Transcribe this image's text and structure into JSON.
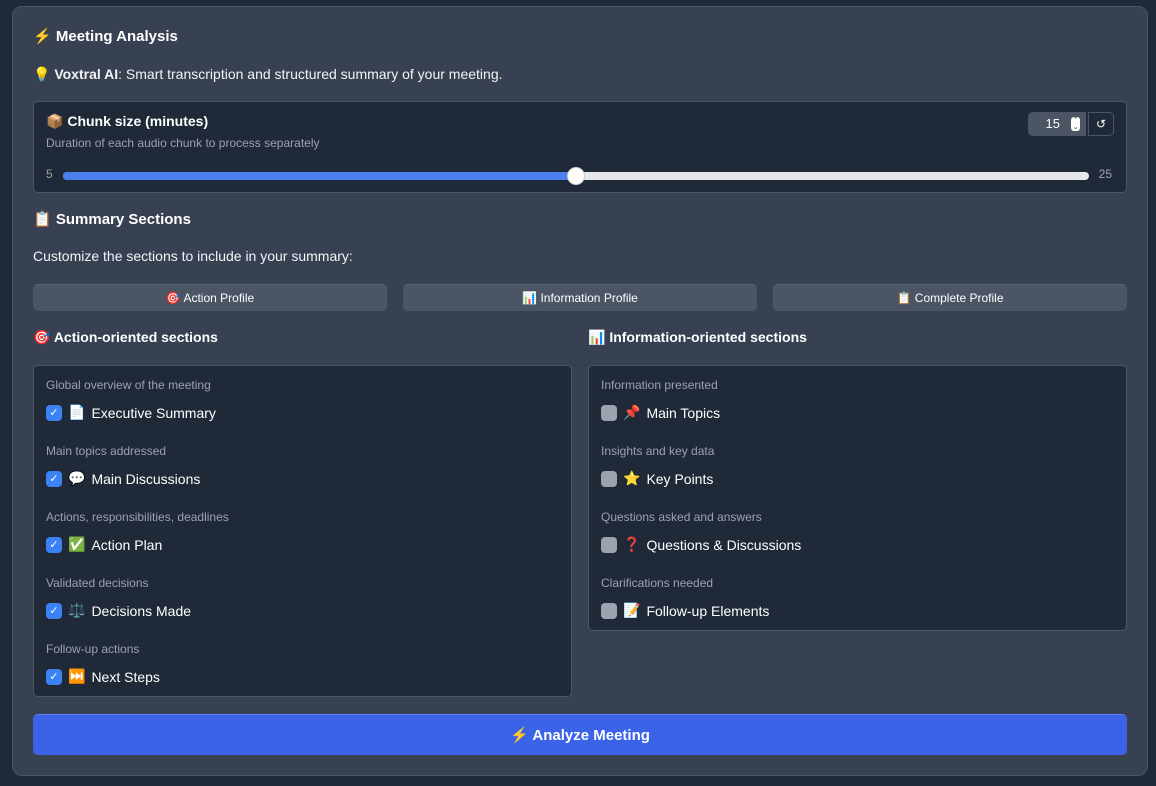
{
  "header": {
    "title": "Meeting Analysis",
    "title_icon": "⚡",
    "info_icon": "💡",
    "info_brand": "Voxtral AI",
    "info_text": ": Smart transcription and structured summary of your meeting."
  },
  "chunk": {
    "icon": "📦",
    "label": "Chunk size (minutes)",
    "description": "Duration of each audio chunk to process separately",
    "min": "5",
    "max": "25",
    "value": "15",
    "reset": "↺"
  },
  "summary": {
    "icon": "📋",
    "title": "Summary Sections",
    "subtitle": "Customize the sections to include in your summary:"
  },
  "profiles": [
    {
      "icon": "🎯",
      "label": "Action Profile"
    },
    {
      "icon": "📊",
      "label": "Information Profile"
    },
    {
      "icon": "📋",
      "label": "Complete Profile"
    }
  ],
  "action": {
    "icon": "🎯",
    "title": "Action-oriented sections",
    "items": [
      {
        "desc": "Global overview of the meeting",
        "icon": "📄",
        "label": "Executive Summary",
        "checked": true
      },
      {
        "desc": "Main topics addressed",
        "icon": "💬",
        "label": "Main Discussions",
        "checked": true
      },
      {
        "desc": "Actions, responsibilities, deadlines",
        "icon": "✅",
        "label": "Action Plan",
        "checked": true
      },
      {
        "desc": "Validated decisions",
        "icon": "⚖️",
        "label": "Decisions Made",
        "checked": true
      },
      {
        "desc": "Follow-up actions",
        "icon": "⏭️",
        "label": "Next Steps",
        "checked": true
      }
    ]
  },
  "info": {
    "icon": "📊",
    "title": "Information-oriented sections",
    "items": [
      {
        "desc": "Information presented",
        "icon": "📌",
        "label": "Main Topics",
        "checked": false
      },
      {
        "desc": "Insights and key data",
        "icon": "⭐",
        "label": "Key Points",
        "checked": false
      },
      {
        "desc": "Questions asked and answers",
        "icon": "❓",
        "label": "Questions & Discussions",
        "checked": false
      },
      {
        "desc": "Clarifications needed",
        "icon": "📝",
        "label": "Follow-up Elements",
        "checked": false
      }
    ]
  },
  "analyze": {
    "icon": "⚡",
    "label": "Analyze Meeting"
  },
  "colors": {
    "accent": "#3b63e8",
    "panel": "#374151",
    "background": "#1f2937"
  }
}
